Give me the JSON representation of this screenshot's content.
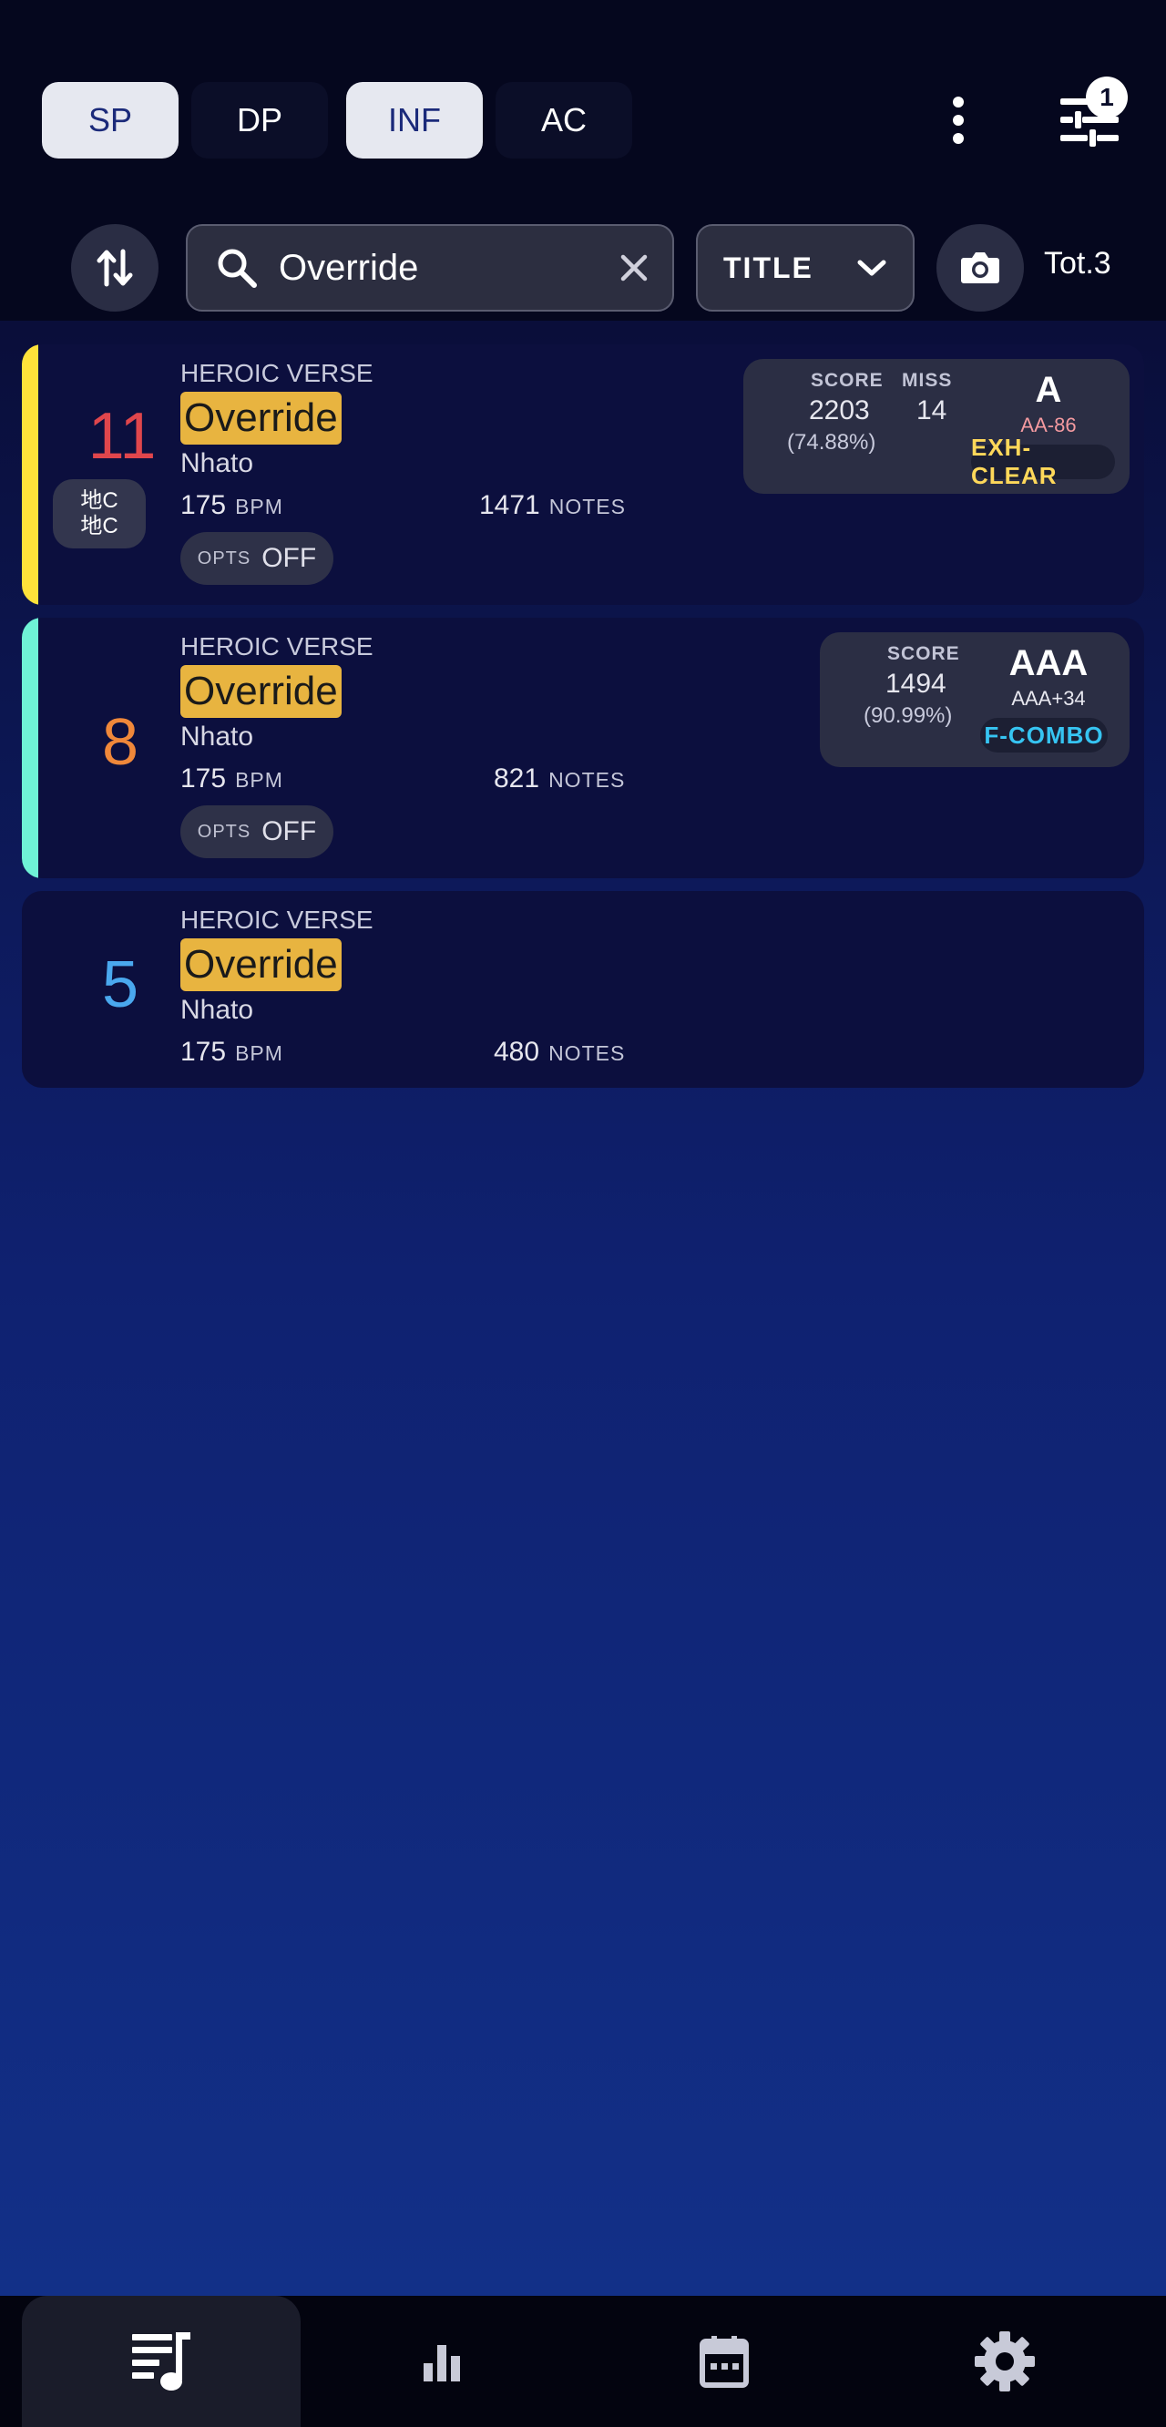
{
  "modes": {
    "play_style": [
      "SP",
      "DP"
    ],
    "version": [
      "INF",
      "AC"
    ],
    "selected_play_style": "SP",
    "selected_version": "INF"
  },
  "filter": {
    "badge_count": "1"
  },
  "search": {
    "value": "Override",
    "placeholder": ""
  },
  "sort_field": {
    "label": "TITLE"
  },
  "total": "Tot.3",
  "songs": [
    {
      "level": "11",
      "level_color": "#e0464c",
      "stripe_color": "#ffe23a",
      "badge": [
        "地C",
        "地C"
      ],
      "series": "HEROIC VERSE",
      "title": "Override",
      "artist": "Nhato",
      "bpm": "175",
      "bpm_unit": "BPM",
      "notes": "1471",
      "notes_unit": "NOTES",
      "opts_label": "OPTS",
      "opts_value": "OFF",
      "score_label": "SCORE",
      "score": "2203",
      "score_pct": "(74.88%)",
      "miss_label": "MISS",
      "miss": "14",
      "grade": "A",
      "grade_diff": "AA-86",
      "grade_diff_color": "#f49aa0",
      "clear_type": "EXH-CLEAR",
      "clear_color": "#ffd85a"
    },
    {
      "level": "8",
      "level_color": "#f0883a",
      "stripe_color": "#6ff2d6",
      "series": "HEROIC VERSE",
      "title": "Override",
      "artist": "Nhato",
      "bpm": "175",
      "bpm_unit": "BPM",
      "notes": "821",
      "notes_unit": "NOTES",
      "opts_label": "OPTS",
      "opts_value": "OFF",
      "score_label": "SCORE",
      "score": "1494",
      "score_pct": "(90.99%)",
      "grade": "AAA",
      "grade_diff": "AAA+34",
      "grade_diff_color": "#e8e8f0",
      "clear_type": "F-COMBO",
      "clear_color": "#36c4f2"
    },
    {
      "level": "5",
      "level_color": "#4aa8ee",
      "series": "HEROIC VERSE",
      "title": "Override",
      "artist": "Nhato",
      "bpm": "175",
      "bpm_unit": "BPM",
      "notes": "480",
      "notes_unit": "NOTES"
    }
  ],
  "nav": [
    "song-list",
    "stats",
    "calendar",
    "settings"
  ]
}
